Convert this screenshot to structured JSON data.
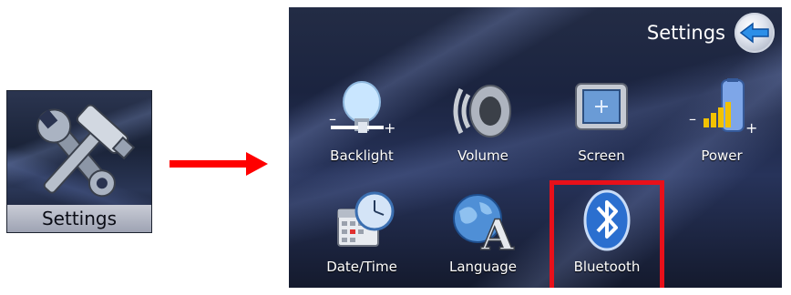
{
  "tile": {
    "label": "Settings",
    "icon": "tools-icon"
  },
  "arrow": {
    "color": "#ff0000"
  },
  "screen": {
    "title": "Settings",
    "back_icon": "back-arrow-icon",
    "items": [
      {
        "label": "Backlight",
        "icon": "backlight-icon"
      },
      {
        "label": "Volume",
        "icon": "volume-icon"
      },
      {
        "label": "Screen",
        "icon": "screen-icon"
      },
      {
        "label": "Power",
        "icon": "power-icon"
      },
      {
        "label": "Date/Time",
        "icon": "date-time-icon"
      },
      {
        "label": "Language",
        "icon": "language-icon"
      },
      {
        "label": "Bluetooth",
        "icon": "bluetooth-icon",
        "highlighted": true
      }
    ],
    "highlight_color": "#e8101a"
  }
}
